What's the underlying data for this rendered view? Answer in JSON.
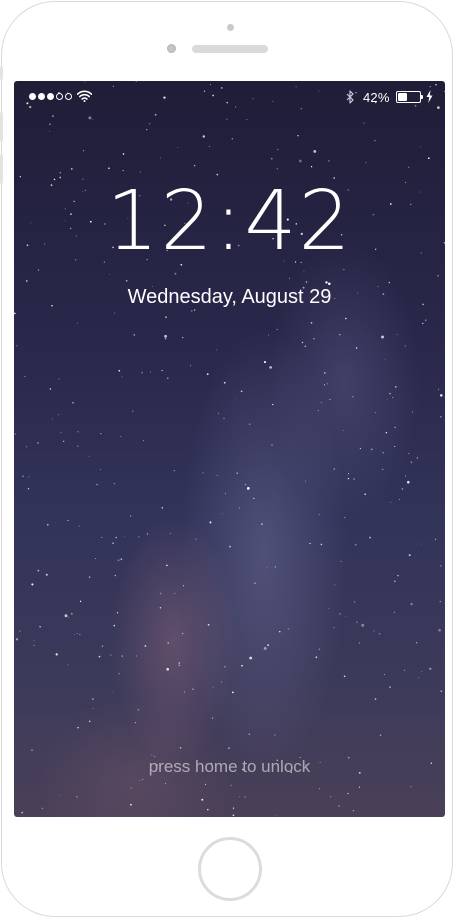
{
  "status_bar": {
    "signal": {
      "filled": 3,
      "total": 5
    },
    "wifi_icon": "wifi-icon",
    "bluetooth_icon": "bluetooth-icon",
    "battery_percent": "42%",
    "battery_level": 0.42,
    "charging_icon": "bolt-icon"
  },
  "lock_screen": {
    "time": "12:42",
    "date": "Wednesday, August 29",
    "unlock_hint": "press home to unlock"
  },
  "wallpaper": {
    "theme": "night sky / milky way",
    "colors": [
      "#1f1d37",
      "#33345a",
      "#4a4058"
    ]
  },
  "device": {
    "frame_color": "#ffffff",
    "home_button_icon": "home-button"
  }
}
